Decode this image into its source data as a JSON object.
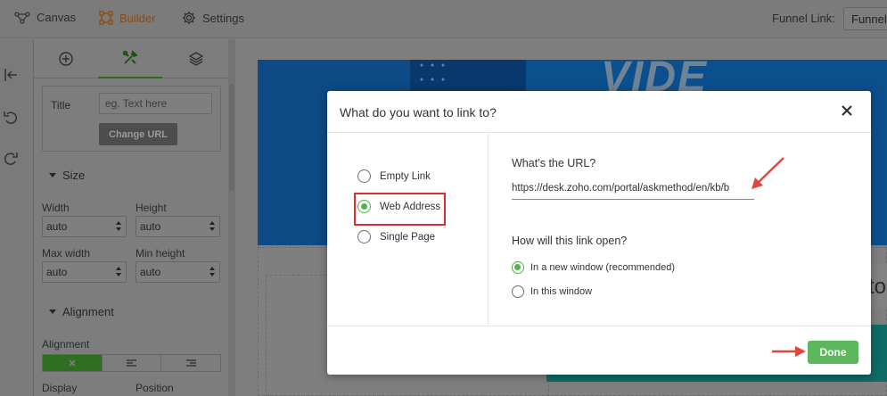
{
  "topbar": {
    "tabs": [
      {
        "label": "Canvas",
        "icon": "canvas-icon"
      },
      {
        "label": "Builder",
        "icon": "builder-icon",
        "active": true
      },
      {
        "label": "Settings",
        "icon": "gear-icon"
      }
    ],
    "funnel_link_label": "Funnel Link:",
    "funnel_link_value": "Funnel"
  },
  "rail": {
    "icons": [
      "collapse-left-icon",
      "undo-icon",
      "redo-icon"
    ]
  },
  "panel": {
    "tabs": [
      "add-element-icon",
      "tools-icon",
      "layers-icon"
    ],
    "active_tab": 1,
    "title_label": "Title",
    "title_placeholder": "eg. Text here",
    "change_url_label": "Change URL",
    "size_heading": "Size",
    "width_label": "Width",
    "width_value": "auto",
    "height_label": "Height",
    "height_value": "auto",
    "max_width_label": "Max width",
    "max_width_value": "auto",
    "min_height_label": "Min height",
    "min_height_value": "auto",
    "alignment_heading": "Alignment",
    "alignment_label": "Alignment",
    "display_label": "Display",
    "position_label": "Position"
  },
  "canvas": {
    "hero_text": "VIDE",
    "right_fragment": "to"
  },
  "modal": {
    "title": "What do you want to link to?",
    "link_types": [
      {
        "label": "Empty Link",
        "selected": false
      },
      {
        "label": "Web Address",
        "selected": true
      },
      {
        "label": "Single Page",
        "selected": false
      }
    ],
    "url_label": "What’s the URL?",
    "url_value": "https://desk.zoho.com/portal/askmethod/en/kb/b",
    "open_label": "How will this link open?",
    "open_options": [
      {
        "label": "In a new window (recommended)",
        "selected": true
      },
      {
        "label": "In this window",
        "selected": false
      }
    ],
    "done_label": "Done"
  },
  "colors": {
    "accent_green": "#5cb85c",
    "radio_green": "#4fb545",
    "highlight_red": "#d9302e"
  }
}
